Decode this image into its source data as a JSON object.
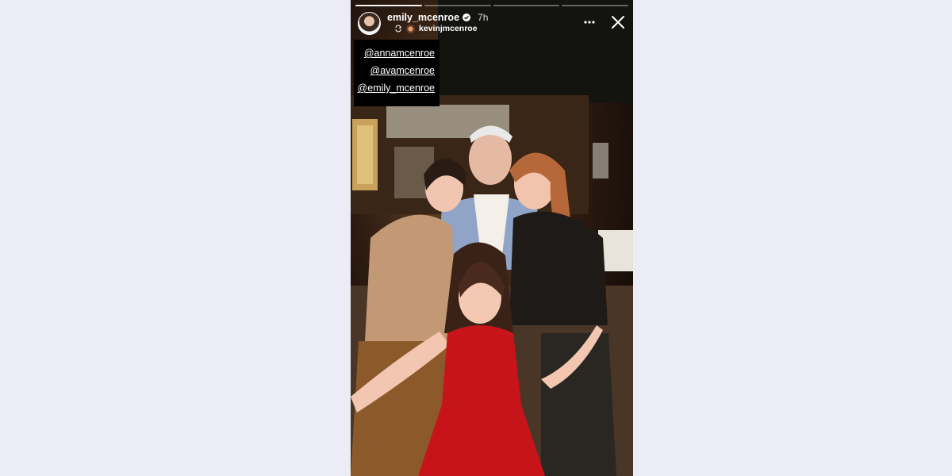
{
  "story": {
    "username": "emily_mcenroe",
    "time": "7h",
    "reposted_from": "kevinjmcenroe",
    "mentions": [
      "@annamcenroe",
      "@avamcenroe",
      "@emily_mcenroe"
    ],
    "progress_segments": 4,
    "progress_active_index": 1
  },
  "icons": {
    "verified": "verified-badge-icon",
    "repost": "repost-icon",
    "more": "more-options-icon",
    "close": "close-icon"
  },
  "colors": {
    "page_background": "#ececf6",
    "story_background": "#0b0705",
    "verified_badge": "#ffffff"
  }
}
